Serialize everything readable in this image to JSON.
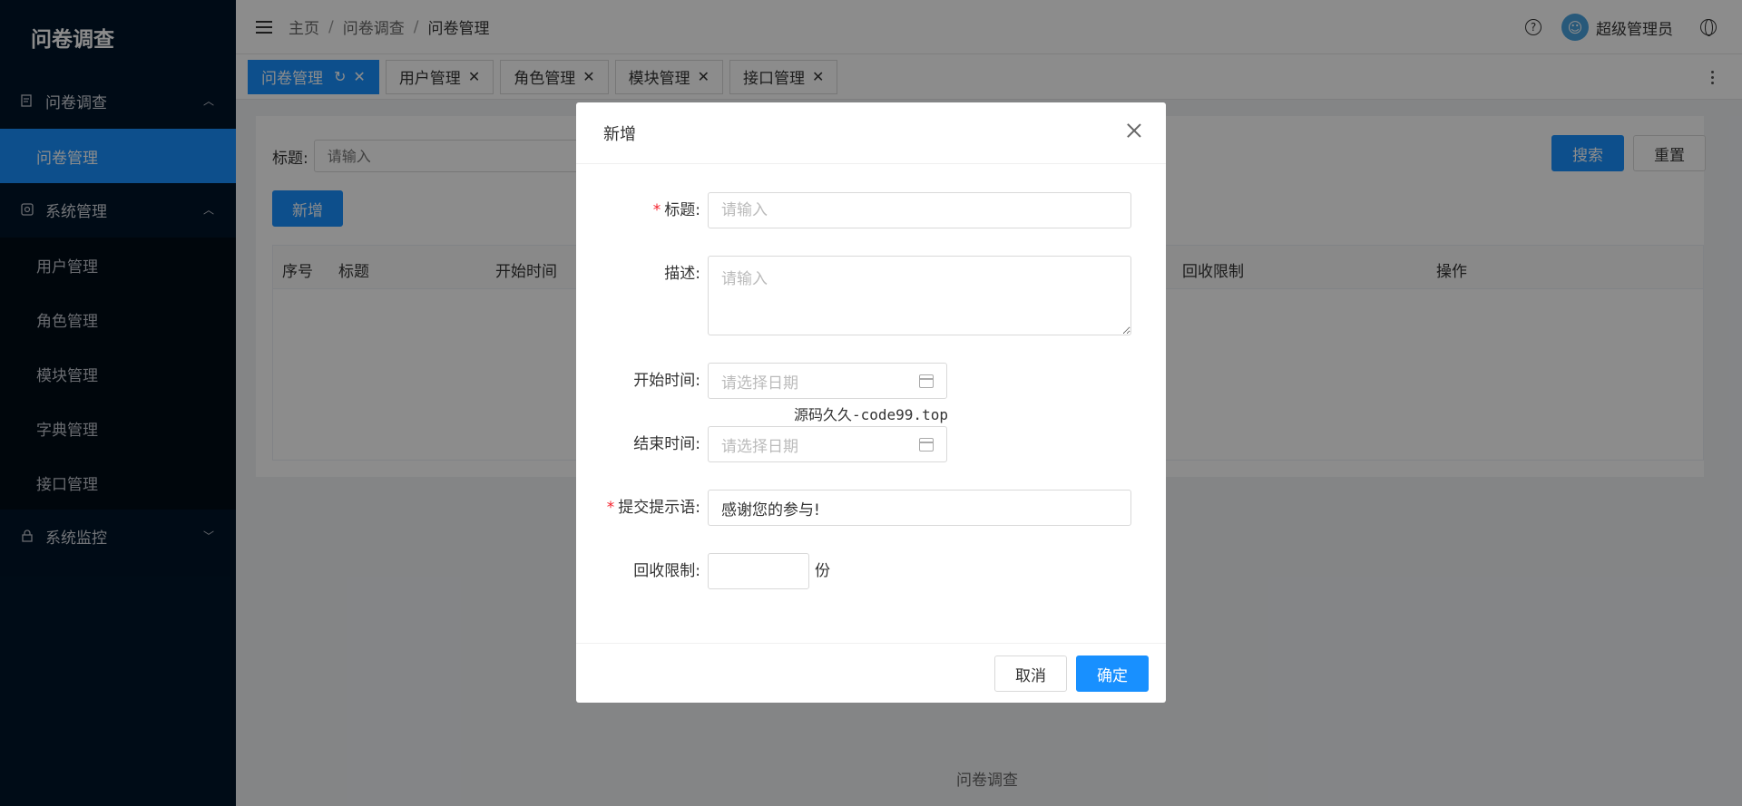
{
  "sidebar": {
    "logo": "问卷调查",
    "groups": [
      {
        "label": "问卷调查",
        "items": [
          "问卷管理"
        ]
      },
      {
        "label": "系统管理",
        "items": [
          "用户管理",
          "角色管理",
          "模块管理",
          "字典管理",
          "接口管理"
        ]
      },
      {
        "label": "系统监控",
        "items": []
      }
    ]
  },
  "header": {
    "breadcrumb": [
      "主页",
      "问卷调查",
      "问卷管理"
    ],
    "separator": "/",
    "user": "超级管理员"
  },
  "tabs": [
    "问卷管理",
    "用户管理",
    "角色管理",
    "模块管理",
    "接口管理"
  ],
  "search": {
    "label": "标题:",
    "placeholder": "请输入",
    "search_btn": "搜索",
    "reset_btn": "重置",
    "add_btn": "新增"
  },
  "table": {
    "columns": [
      "序号",
      "标题",
      "开始时间",
      "回收限制",
      "操作"
    ]
  },
  "footer": "问卷调查",
  "modal": {
    "title": "新增",
    "title_label": "标题:",
    "title_placeholder": "请输入",
    "desc_label": "描述:",
    "desc_placeholder": "请输入",
    "start_label": "开始时间:",
    "start_placeholder": "请选择日期",
    "end_label": "结束时间:",
    "end_placeholder": "请选择日期",
    "tip_label": "提交提示语:",
    "tip_value": "感谢您的参与!",
    "limit_label": "回收限制:",
    "limit_unit": "份",
    "cancel": "取消",
    "ok": "确定"
  },
  "promo": "源码久久-code99.top"
}
